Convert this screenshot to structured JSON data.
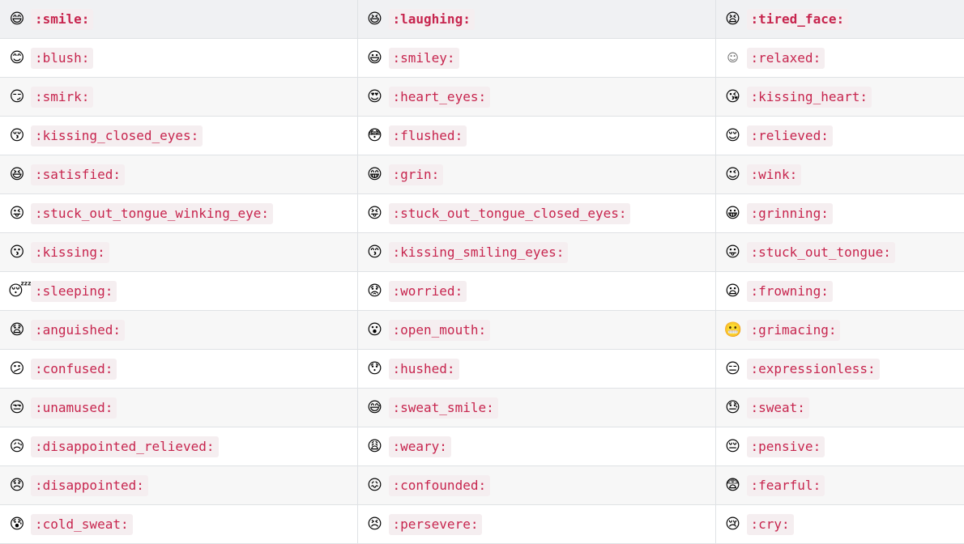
{
  "rows": [
    [
      {
        "glyph": "😄",
        "icon": "smile-icon",
        "code": ":smile:"
      },
      {
        "glyph": "😆",
        "icon": "laughing-icon",
        "code": ":laughing:"
      },
      {
        "glyph": "😫",
        "icon": "tired-face-icon",
        "code": ":tired_face:"
      }
    ],
    [
      {
        "glyph": "😊",
        "icon": "blush-icon",
        "code": ":blush:"
      },
      {
        "glyph": "😃",
        "icon": "smiley-icon",
        "code": ":smiley:"
      },
      {
        "glyph": "☺",
        "icon": "relaxed-icon",
        "code": ":relaxed:"
      }
    ],
    [
      {
        "glyph": "😏",
        "icon": "smirk-icon",
        "code": ":smirk:"
      },
      {
        "glyph": "😍",
        "icon": "heart-eyes-icon",
        "code": ":heart_eyes:"
      },
      {
        "glyph": "😘",
        "icon": "kissing-heart-icon",
        "code": ":kissing_heart:"
      }
    ],
    [
      {
        "glyph": "😚",
        "icon": "kissing-closed-eyes-icon",
        "code": ":kissing_closed_eyes:"
      },
      {
        "glyph": "😳",
        "icon": "flushed-icon",
        "code": ":flushed:"
      },
      {
        "glyph": "😌",
        "icon": "relieved-icon",
        "code": ":relieved:"
      }
    ],
    [
      {
        "glyph": "😆",
        "icon": "satisfied-icon",
        "code": ":satisfied:"
      },
      {
        "glyph": "😁",
        "icon": "grin-icon",
        "code": ":grin:"
      },
      {
        "glyph": "😉",
        "icon": "wink-icon",
        "code": ":wink:"
      }
    ],
    [
      {
        "glyph": "😜",
        "icon": "stuck-out-tongue-winking-eye-icon",
        "code": ":stuck_out_tongue_winking_eye:"
      },
      {
        "glyph": "😝",
        "icon": "stuck-out-tongue-closed-eyes-icon",
        "code": ":stuck_out_tongue_closed_eyes:"
      },
      {
        "glyph": "😀",
        "icon": "grinning-icon",
        "code": ":grinning:"
      }
    ],
    [
      {
        "glyph": "😗",
        "icon": "kissing-icon",
        "code": ":kissing:"
      },
      {
        "glyph": "😙",
        "icon": "kissing-smiling-eyes-icon",
        "code": ":kissing_smiling_eyes:"
      },
      {
        "glyph": "😛",
        "icon": "stuck-out-tongue-icon",
        "code": ":stuck_out_tongue:"
      }
    ],
    [
      {
        "glyph": "😴",
        "icon": "sleeping-icon",
        "code": ":sleeping:"
      },
      {
        "glyph": "😟",
        "icon": "worried-icon",
        "code": ":worried:"
      },
      {
        "glyph": "😦",
        "icon": "frowning-icon",
        "code": ":frowning:"
      }
    ],
    [
      {
        "glyph": "😧",
        "icon": "anguished-icon",
        "code": ":anguished:"
      },
      {
        "glyph": "😮",
        "icon": "open-mouth-icon",
        "code": ":open_mouth:"
      },
      {
        "glyph": "😬",
        "icon": "grimacing-icon",
        "code": ":grimacing:"
      }
    ],
    [
      {
        "glyph": "😕",
        "icon": "confused-icon",
        "code": ":confused:"
      },
      {
        "glyph": "😯",
        "icon": "hushed-icon",
        "code": ":hushed:"
      },
      {
        "glyph": "😑",
        "icon": "expressionless-icon",
        "code": ":expressionless:"
      }
    ],
    [
      {
        "glyph": "😒",
        "icon": "unamused-icon",
        "code": ":unamused:"
      },
      {
        "glyph": "😅",
        "icon": "sweat-smile-icon",
        "code": ":sweat_smile:"
      },
      {
        "glyph": "😓",
        "icon": "sweat-icon",
        "code": ":sweat:"
      }
    ],
    [
      {
        "glyph": "😥",
        "icon": "disappointed-relieved-icon",
        "code": ":disappointed_relieved:"
      },
      {
        "glyph": "😩",
        "icon": "weary-icon",
        "code": ":weary:"
      },
      {
        "glyph": "😔",
        "icon": "pensive-icon",
        "code": ":pensive:"
      }
    ],
    [
      {
        "glyph": "😞",
        "icon": "disappointed-icon",
        "code": ":disappointed:"
      },
      {
        "glyph": "😖",
        "icon": "confounded-icon",
        "code": ":confounded:"
      },
      {
        "glyph": "😨",
        "icon": "fearful-icon",
        "code": ":fearful:"
      }
    ],
    [
      {
        "glyph": "😰",
        "icon": "cold-sweat-icon",
        "code": ":cold_sweat:"
      },
      {
        "glyph": "😣",
        "icon": "persevere-icon",
        "code": ":persevere:"
      },
      {
        "glyph": "😢",
        "icon": "cry-icon",
        "code": ":cry:"
      }
    ]
  ]
}
